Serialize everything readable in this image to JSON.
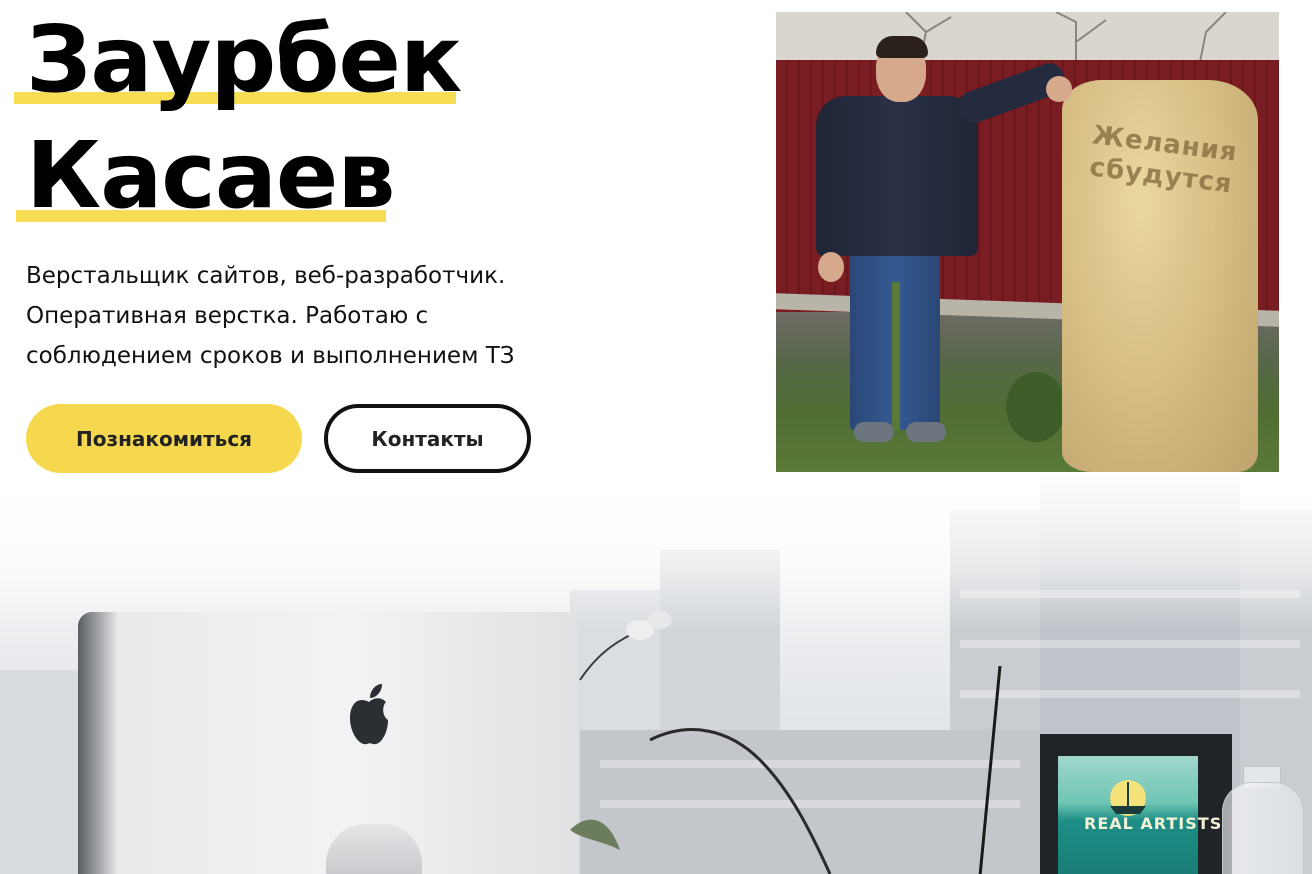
{
  "hero": {
    "name_line1": "Заурбек",
    "name_line2": "Касаев",
    "description": "Верстальщик сайтов, веб-разработчик. Оперативная верстка. Работаю с соблюдением сроков и выполнением ТЗ",
    "primary_button": "Познакомиться",
    "secondary_button": "Контакты"
  },
  "photo": {
    "stone_inscription": "Желания сбудутся"
  },
  "background": {
    "poster_text": "REAL ARTISTS"
  },
  "colors": {
    "accent_yellow": "#f6d84e",
    "highlight_yellow": "#f6dd53",
    "text": "#000000"
  },
  "icons": [
    "apple-logo-icon"
  ]
}
